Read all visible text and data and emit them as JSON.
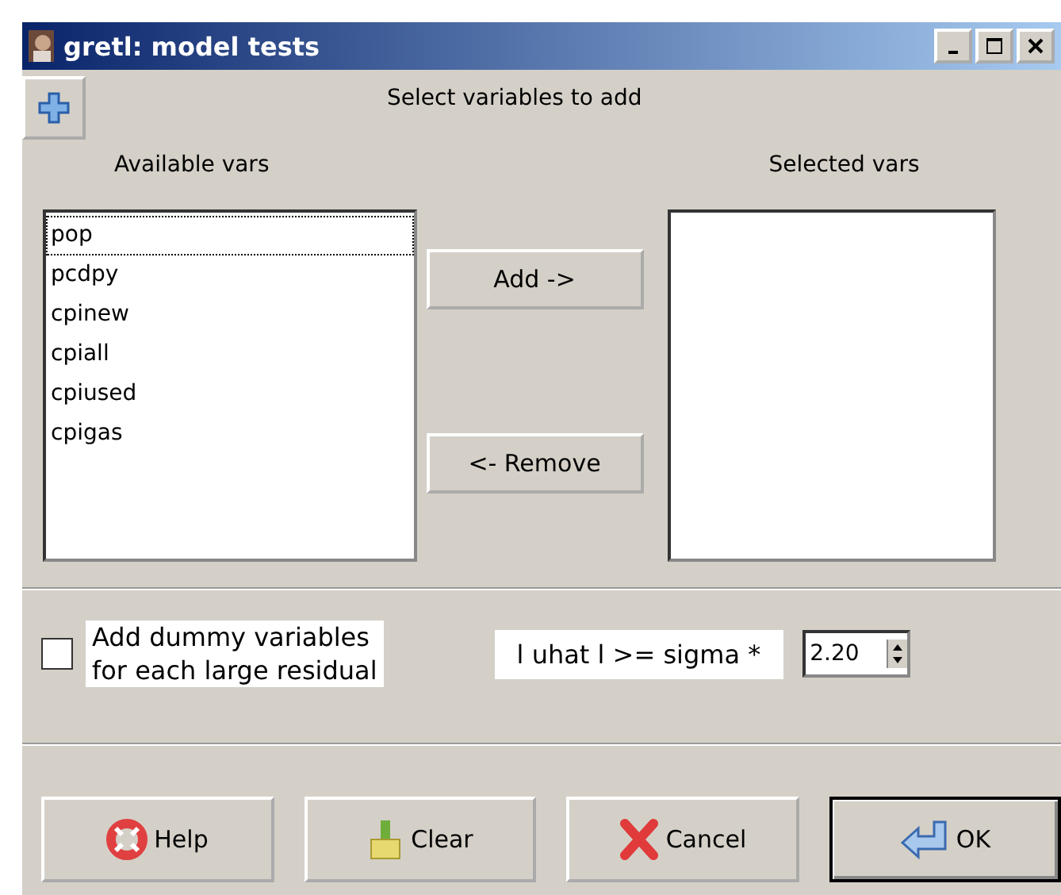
{
  "window": {
    "title": "gretl: model tests"
  },
  "heading": "Select variables to add",
  "available": {
    "label": "Available vars",
    "items": [
      {
        "name": "pop",
        "focused": true
      },
      {
        "name": "pcdpy",
        "focused": false
      },
      {
        "name": "cpinew",
        "focused": false
      },
      {
        "name": "cpiall",
        "focused": false
      },
      {
        "name": "cpiused",
        "focused": false
      },
      {
        "name": "cpigas",
        "focused": false
      }
    ]
  },
  "selected": {
    "label": "Selected vars"
  },
  "move_buttons": [
    "Add ->",
    "<- Remove"
  ],
  "dummy": {
    "label": "Add dummy variables\nfor each large residual",
    "checked": false
  },
  "threshold": {
    "label": "l uhat l >= sigma *",
    "value": "2.20"
  },
  "buttons": [
    {
      "kind": "help",
      "label": "Help"
    },
    {
      "kind": "clear",
      "label": "Clear"
    },
    {
      "kind": "cancel",
      "label": "Cancel"
    },
    {
      "kind": "ok",
      "label": "OK"
    }
  ]
}
